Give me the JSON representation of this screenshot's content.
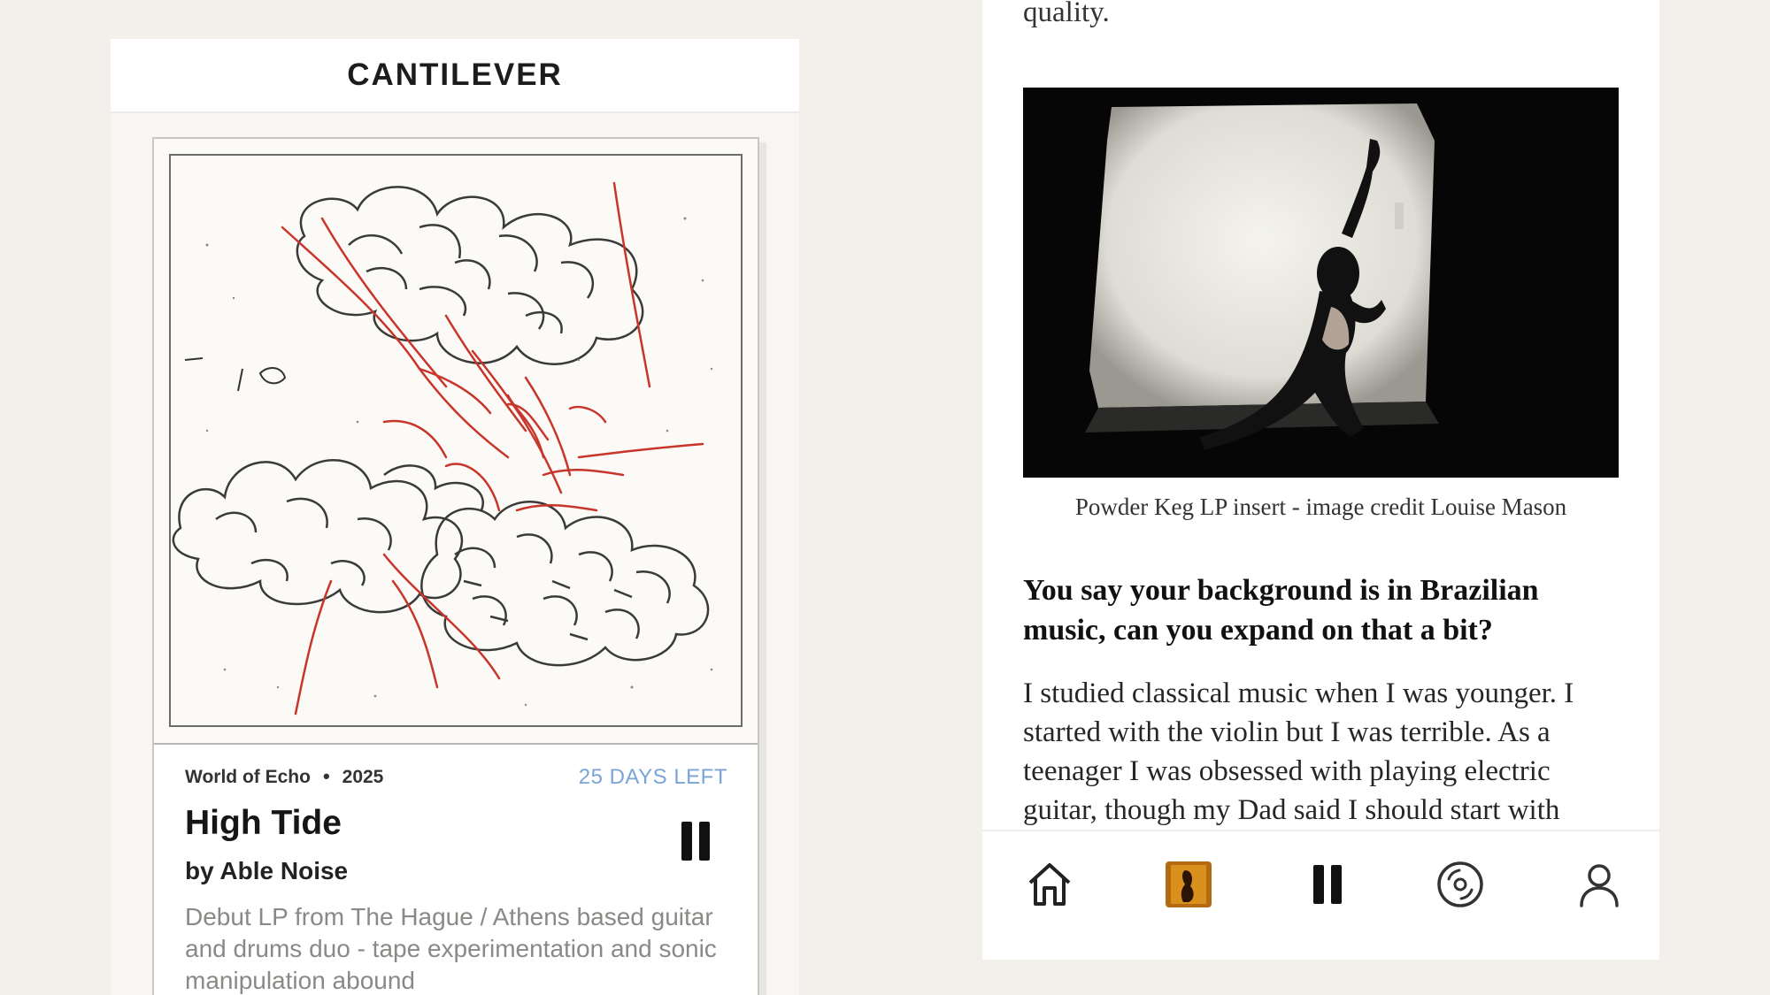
{
  "left_screen": {
    "brand": "CANTILEVER",
    "release": {
      "label": "World of Echo",
      "separator": "•",
      "year": "2025",
      "days_left": "25 DAYS LEFT",
      "title": "High Tide",
      "artist": "by Able Noise",
      "description": "Debut LP from The Hague / Athens based guitar and drums duo - tape experimentation and sonic manipulation abound"
    },
    "colors": {
      "days_left": "#7aa4d8",
      "sketch_red": "#c8352b"
    }
  },
  "right_screen": {
    "top_text": "quality.",
    "photo_caption": "Powder Keg LP insert - image credit Louise Mason",
    "question": "You say your background is in Brazilian music, can you expand on that a bit?",
    "answer": "I studied classical music when I was younger. I started with the violin but I was terrible. As a teenager I was obsessed with playing electric guitar, though my Dad said I should start with",
    "nav_icons": [
      "home-icon",
      "album-thumbnail",
      "pause-icon",
      "vinyl-icon",
      "profile-icon"
    ]
  }
}
